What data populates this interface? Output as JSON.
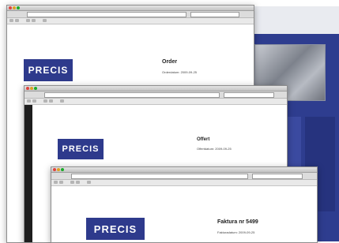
{
  "windows": [
    {
      "logo": "PRECIS",
      "doc_title": "Order",
      "doc_date": "Orderdatum: 2009-09-25"
    },
    {
      "logo": "PRECIS",
      "doc_title": "Offert",
      "doc_date": "Offertdatum: 2009-09-25"
    },
    {
      "logo": "PRECIS",
      "doc_title": "Faktura nr 5499",
      "doc_date": "Fakturadatum: 2009-09-25"
    }
  ],
  "colors": {
    "brand": "#2e3a8c",
    "site_background": "#2e3d8f"
  }
}
